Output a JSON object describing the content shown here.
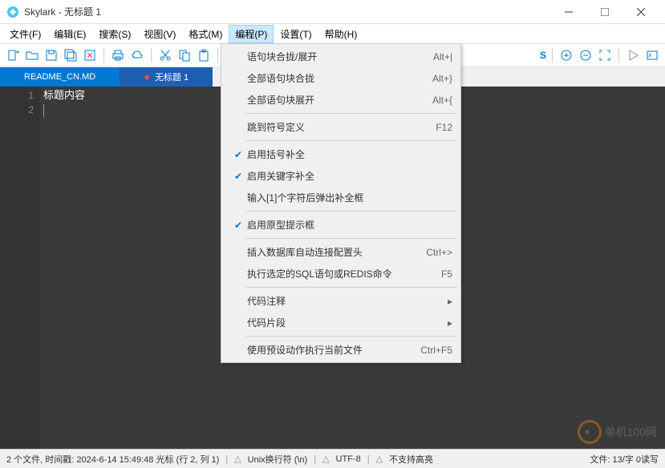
{
  "title": "Skylark - 无标题 1",
  "menubar": [
    "文件(F)",
    "编辑(E)",
    "搜索(S)",
    "视图(V)",
    "格式(M)",
    "编程(P)",
    "设置(T)",
    "帮助(H)"
  ],
  "active_menu_index": 5,
  "tabs": [
    {
      "label": "README_CN.MD",
      "active": false
    },
    {
      "label": "无标题 1",
      "active": true
    }
  ],
  "editor": {
    "lines": [
      "1",
      "2"
    ],
    "content": "标题内容"
  },
  "dropdown": {
    "groups": [
      [
        {
          "label": "语句块合拢/展开",
          "shortcut": "Alt+|",
          "checked": false
        },
        {
          "label": "全部语句块合拢",
          "shortcut": "Alt+}",
          "checked": false
        },
        {
          "label": "全部语句块展开",
          "shortcut": "Alt+{",
          "checked": false
        }
      ],
      [
        {
          "label": "跳到符号定义",
          "shortcut": "F12",
          "checked": false
        }
      ],
      [
        {
          "label": "启用括号补全",
          "shortcut": "",
          "checked": true
        },
        {
          "label": "启用关键字补全",
          "shortcut": "",
          "checked": true
        },
        {
          "label": "输入[1]个字符后弹出补全框",
          "shortcut": "",
          "checked": false
        }
      ],
      [
        {
          "label": "启用原型提示框",
          "shortcut": "",
          "checked": true
        }
      ],
      [
        {
          "label": "插入数据库自动连接配置头",
          "shortcut": "Ctrl+>",
          "checked": false
        },
        {
          "label": "执行选定的SQL语句或REDIS命令",
          "shortcut": "F5",
          "checked": false
        }
      ],
      [
        {
          "label": "代码注释",
          "shortcut": "",
          "checked": false,
          "submenu": true
        },
        {
          "label": "代码片段",
          "shortcut": "",
          "checked": false,
          "submenu": true
        }
      ],
      [
        {
          "label": "使用预设动作执行当前文件",
          "shortcut": "Ctrl+F5",
          "checked": false
        }
      ]
    ]
  },
  "status": {
    "left": "2 个文件, 时间戳: 2024-6-14 15:49:48 光标 (行 2, 列 1)",
    "items": [
      "Unix换行符 (\\n)",
      "UTF-8",
      "不支持高亮"
    ],
    "right": "文件: 13/字  0读写"
  },
  "watermark": "单机100网"
}
